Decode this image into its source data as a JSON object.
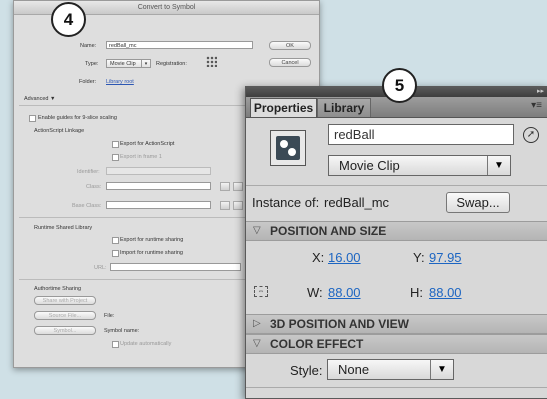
{
  "callouts": {
    "dialog": "4",
    "panel": "5"
  },
  "dialog": {
    "title": "Convert to Symbol",
    "name_label": "Name:",
    "name_value": "redBall_mc",
    "type_label": "Type:",
    "type_value": "Movie Clip",
    "registration_label": "Registration:",
    "folder_label": "Folder:",
    "folder_value": "Library root",
    "ok": "OK",
    "cancel": "Cancel",
    "advanced": "Advanced ▼",
    "nine_slice": "Enable guides for 9-slice scaling",
    "as_linkage": "ActionScript Linkage",
    "export_as": "Export for ActionScript",
    "export_frame1": "Export in frame 1",
    "identifier": "Identifier:",
    "class": "Class:",
    "base_class": "Base Class:",
    "rsl": "Runtime Shared Library",
    "export_runtime": "Export for runtime sharing",
    "import_runtime": "Import for runtime sharing",
    "url": "URL:",
    "authortime": "Authortime Sharing",
    "share_project": "Share with Project",
    "source_file": "Source File...",
    "file": "File:",
    "symbol_btn": "Symbol...",
    "symbol_name": "Symbol name:",
    "update_auto": "Update automatically"
  },
  "panel": {
    "tabs": [
      "Properties",
      "Library"
    ],
    "instance_name": "redBall",
    "symbol_type": "Movie Clip",
    "instance_of_label": "Instance of:",
    "instance_of": "redBall_mc",
    "swap": "Swap...",
    "pos_section": "POSITION AND SIZE",
    "x_label": "X:",
    "x_value": "16.00",
    "y_label": "Y:",
    "y_value": "97.95",
    "w_label": "W:",
    "w_value": "88.00",
    "h_label": "H:",
    "h_value": "88.00",
    "pos3d_section": "3D POSITION AND VIEW",
    "color_section": "COLOR EFFECT",
    "style_label": "Style:",
    "style_value": "None"
  },
  "colors": {
    "link": "#1c65c2",
    "background": "#cfe0e6"
  }
}
